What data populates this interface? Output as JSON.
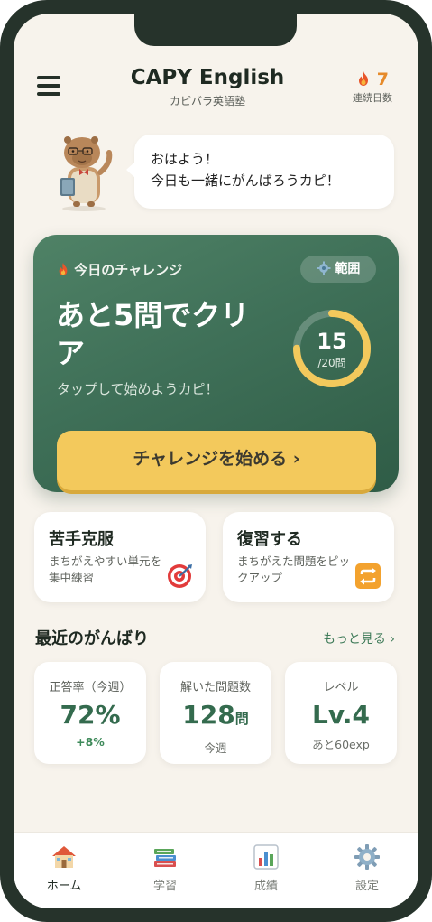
{
  "header": {
    "title": "CAPY English",
    "subtitle": "カピバラ英語塾",
    "streak_count": "7",
    "streak_label": "連続日数"
  },
  "mascot": {
    "greeting_line1": "おはよう！",
    "greeting_line2": "今日も一緒にがんばろうカピ！"
  },
  "challenge": {
    "label": "今日のチャレンジ",
    "range_button": "範囲",
    "title": "あと5問でクリア",
    "subtitle": "タップして始めようカピ！",
    "progress_done": 15,
    "progress_total": 20,
    "progress_number": "15",
    "progress_denominator": "/20問",
    "start_button": "チャレンジを始める ›"
  },
  "actions": [
    {
      "title": "苦手克服",
      "desc": "まちがえやすい単元を集中練習",
      "icon": "target-icon"
    },
    {
      "title": "復習する",
      "desc": "まちがえた問題をピックアップ",
      "icon": "repeat-icon"
    }
  ],
  "recent": {
    "title": "最近のがんばり",
    "more": "もっと見る ›",
    "stats": [
      {
        "label": "正答率（今週）",
        "value": "72%",
        "unit": "",
        "note": "+8%"
      },
      {
        "label": "解いた問題数",
        "value": "128",
        "unit": "問",
        "note": "今週"
      },
      {
        "label": "レベル",
        "value": "Lv.4",
        "unit": "",
        "note": "あと60exp"
      }
    ]
  },
  "nav": [
    {
      "label": "ホーム",
      "icon": "home-icon",
      "active": true
    },
    {
      "label": "学習",
      "icon": "books-icon",
      "active": false
    },
    {
      "label": "成績",
      "icon": "bar-chart-icon",
      "active": false
    },
    {
      "label": "設定",
      "icon": "gear-icon",
      "active": false
    }
  ],
  "colors": {
    "accent_green": "#346b4e",
    "card_green": "#3f7058",
    "button_yellow": "#f3c95c",
    "streak_orange": "#e68a2a",
    "background": "#f7f3ec"
  }
}
